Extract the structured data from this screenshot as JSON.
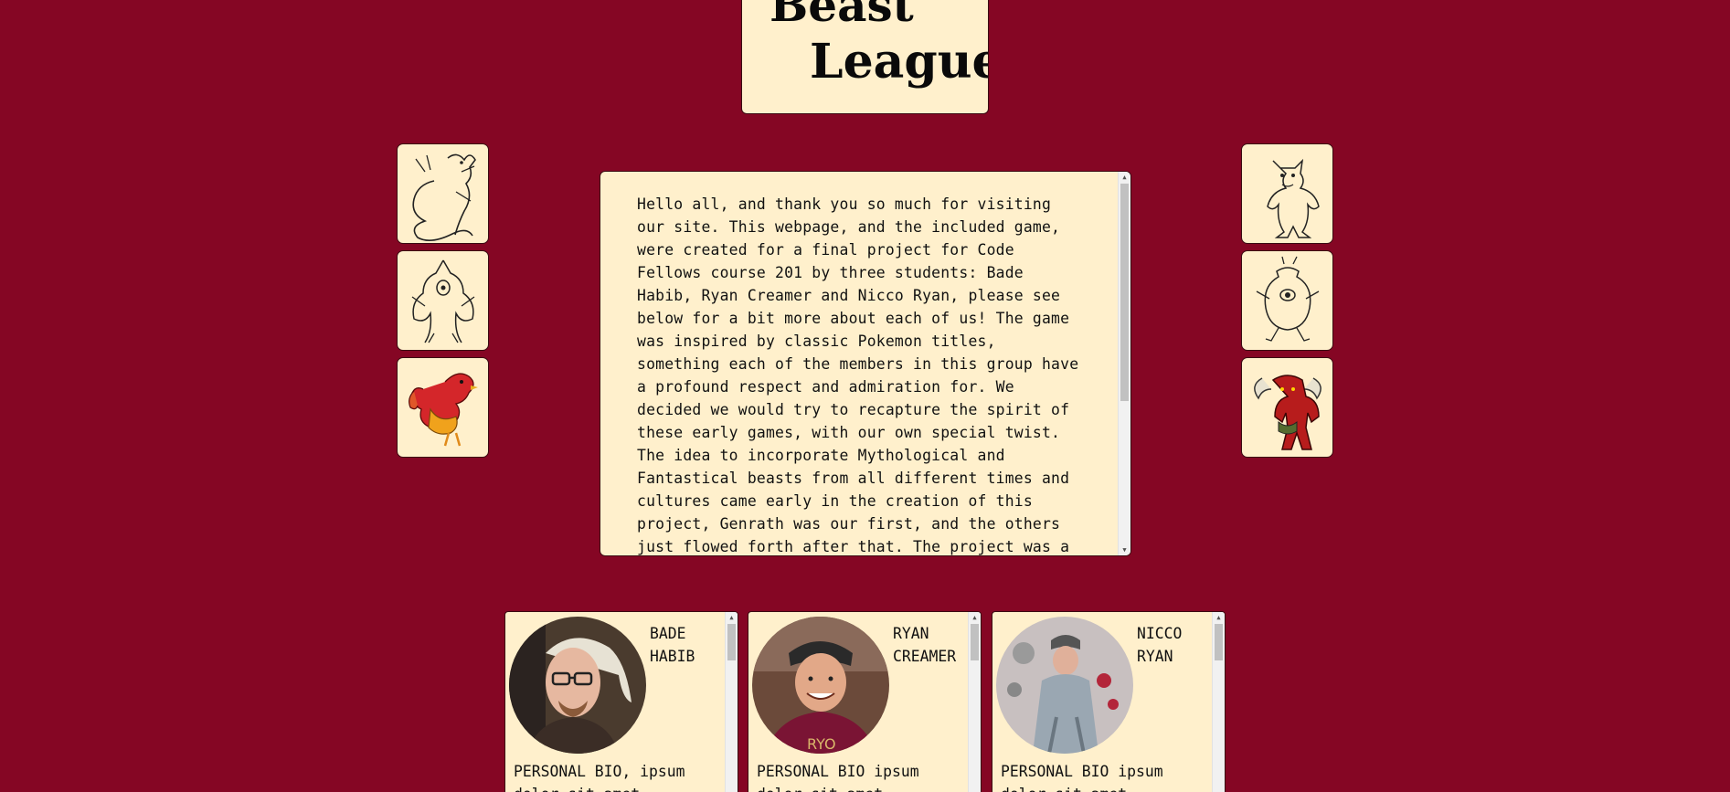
{
  "site": {
    "logo_text_line1": "Beast",
    "logo_text_line2": "League"
  },
  "beasts_left": [
    {
      "name": "serpent-dragon-sketch"
    },
    {
      "name": "cyclops-beast-sketch"
    },
    {
      "name": "red-rooster-dragon"
    }
  ],
  "beasts_right": [
    {
      "name": "werewolf-sketch"
    },
    {
      "name": "one-eyed-pot-creature-sketch"
    },
    {
      "name": "red-horned-demon"
    }
  ],
  "intro": {
    "text": "Hello all, and thank you so much for visiting our site. This webpage, and the included game, were created for a final project for Code Fellows course 201 by three students: Bade Habib, Ryan Creamer and Nicco Ryan, please see below for a bit more about each of us! The game was inspired by classic Pokemon titles, something each of the members in this group have a profound respect and admiration for. We decided we would try to recapture the spirit of these early games, with our own special twist. The idea to incorporate Mythological and Fantastical beasts from all different times and cultures came early in the creation of this project, Genrath was our first, and the others just flowed forth after that. The project was a learning experience for all of us,"
  },
  "team": [
    {
      "first": "BADE",
      "last": "HABIB",
      "bio": "PERSONAL BIO, ipsum dolor sit amet",
      "avatar_bg": "#4a3b2e",
      "shirt": "#3b2d26"
    },
    {
      "first": "RYAN",
      "last": "CREAMER",
      "bio": "PERSONAL BIO ipsum dolor sit amet",
      "avatar_bg": "#6b4a3a",
      "shirt": "#7a1434"
    },
    {
      "first": "NICCO",
      "last": "RYAN",
      "bio": "PERSONAL BIO ipsum dolor sit amet",
      "avatar_bg": "#c8c0c0",
      "shirt": "#9aa7b2"
    }
  ]
}
